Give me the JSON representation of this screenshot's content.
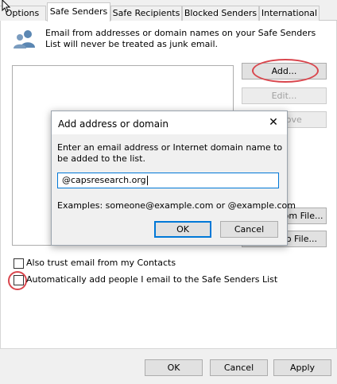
{
  "tabs": [
    {
      "label": "Options",
      "active": false
    },
    {
      "label": "Safe Senders",
      "active": true
    },
    {
      "label": "Safe Recipients",
      "active": false
    },
    {
      "label": "Blocked Senders",
      "active": false
    },
    {
      "label": "International",
      "active": false
    }
  ],
  "description": "Email from addresses or domain names on your Safe Senders List will never be treated as junk email.",
  "icon": "people-icon",
  "buttons": {
    "add": "Add...",
    "edit": "Edit...",
    "remove": "Remove",
    "import": "Import from File...",
    "export": "Export to File..."
  },
  "checkboxes": {
    "trust_contacts": {
      "label": "Also trust email from my Contacts",
      "checked": false
    },
    "auto_add": {
      "label": "Automatically add people I email to the Safe Senders List",
      "checked": false
    }
  },
  "dialog": {
    "title": "Add address or domain",
    "prompt": "Enter an email address or Internet domain name to be added to the list.",
    "input_value": "@capsresearch.org",
    "examples": "Examples: someone@example.com or @example.com",
    "ok": "OK",
    "cancel": "Cancel",
    "close_symbol": "✕"
  },
  "footer": {
    "ok": "OK",
    "cancel": "Cancel",
    "apply": "Apply"
  },
  "colors": {
    "highlight_ring": "#d9464d",
    "focus_border": "#0078d7",
    "people_icon": "#5b87b3"
  }
}
